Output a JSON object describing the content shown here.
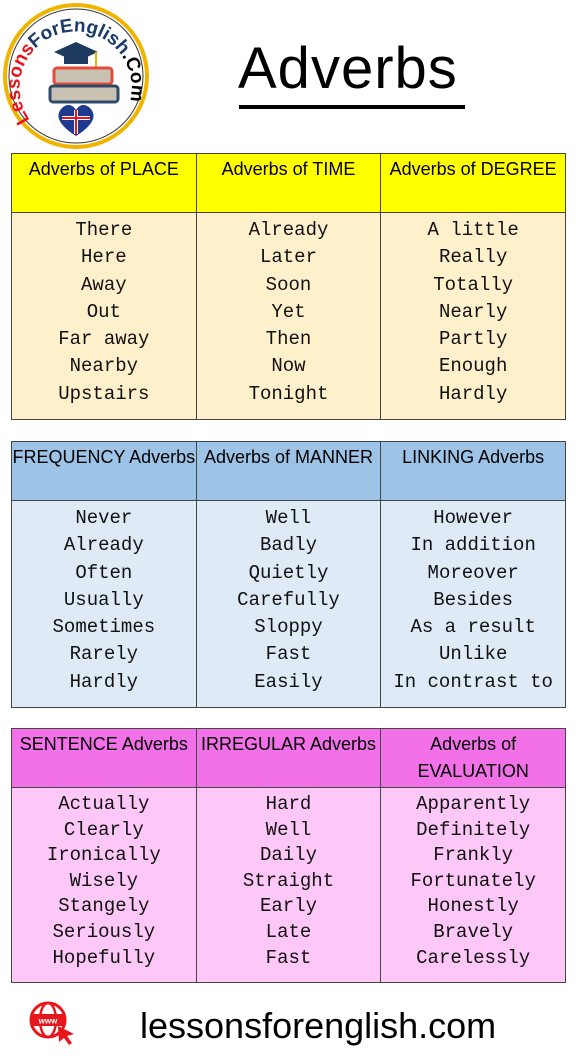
{
  "logo": {
    "text": "LessonsForEnglish.Com"
  },
  "title": "Adverbs",
  "tables": [
    {
      "headers": [
        "Adverbs of PLACE",
        "Adverbs of TIME",
        "Adverbs of DEGREE"
      ],
      "columns": [
        [
          "There",
          "Here",
          "Away",
          "Out",
          "Far away",
          "Nearby",
          "Upstairs"
        ],
        [
          "Already",
          "Later",
          "Soon",
          "Yet",
          "Then",
          "Now",
          "Tonight"
        ],
        [
          "A little",
          "Really",
          "Totally",
          "Nearly",
          "Partly",
          "Enough",
          "Hardly"
        ]
      ]
    },
    {
      "headers": [
        "FREQUENCY Adverbs",
        "Adverbs of MANNER",
        "LINKING Adverbs"
      ],
      "columns": [
        [
          "Never",
          "Already",
          "Often",
          "Usually",
          "Sometimes",
          "Rarely",
          "Hardly"
        ],
        [
          "Well",
          "Badly",
          "Quietly",
          "Carefully",
          "Sloppy",
          "Fast",
          "Easily"
        ],
        [
          "However",
          "In addition",
          "Moreover",
          "Besides",
          "As a result",
          "Unlike",
          "In contrast to"
        ]
      ]
    },
    {
      "headers": [
        "SENTENCE Adverbs",
        "IRREGULAR Adverbs",
        "Adverbs of EVALUATION"
      ],
      "columns": [
        [
          "Actually",
          "Clearly",
          "Ironically",
          "Wisely",
          "Stangely",
          "Seriously",
          "Hopefully"
        ],
        [
          "Hard",
          "Well",
          "Daily",
          "Straight",
          "Early",
          "Late",
          "Fast"
        ],
        [
          "Apparently",
          "Definitely",
          "Frankly",
          "Fortunately",
          "Honestly",
          "Bravely",
          "Carelessly"
        ]
      ]
    }
  ],
  "footer": {
    "icon": "globe-www-icon",
    "url": "lessonsforenglish.com"
  },
  "colors": {
    "table1_header": "#ffff00",
    "table1_body": "#fff0cc",
    "table2_header": "#9dc3e6",
    "table2_body": "#deebf7",
    "table3_header": "#f371e8",
    "table3_body": "#fdc8f8",
    "footer_icon": "#e8161b"
  }
}
